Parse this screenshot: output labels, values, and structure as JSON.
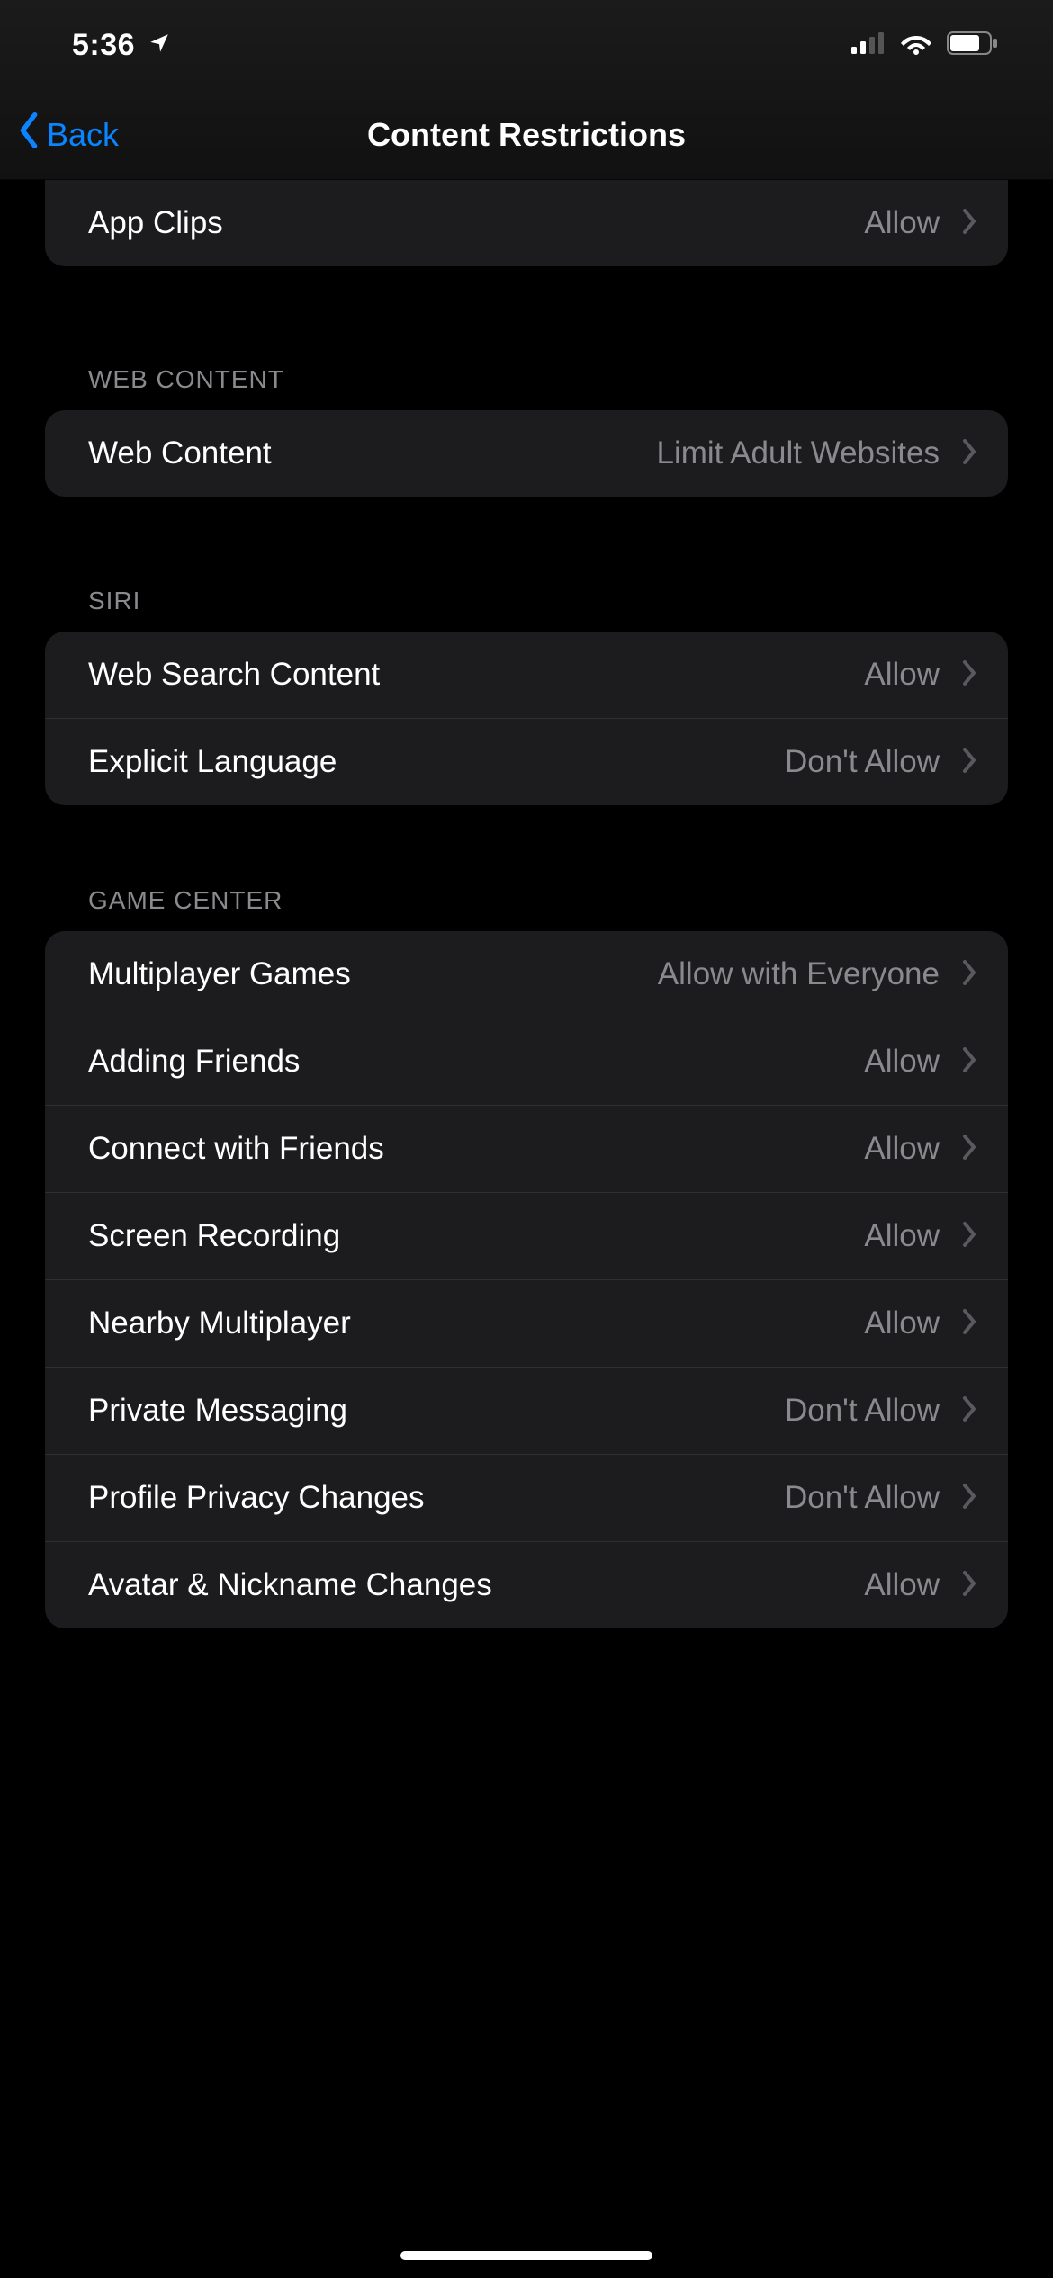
{
  "statusBar": {
    "time": "5:36"
  },
  "nav": {
    "back": "Back",
    "title": "Content Restrictions"
  },
  "groups": {
    "top": {
      "items": [
        {
          "label": "App Clips",
          "value": "Allow"
        }
      ]
    },
    "webContent": {
      "header": "WEB CONTENT",
      "items": [
        {
          "label": "Web Content",
          "value": "Limit Adult Websites"
        }
      ]
    },
    "siri": {
      "header": "SIRI",
      "items": [
        {
          "label": "Web Search Content",
          "value": "Allow"
        },
        {
          "label": "Explicit Language",
          "value": "Don't Allow"
        }
      ]
    },
    "gameCenter": {
      "header": "GAME CENTER",
      "items": [
        {
          "label": "Multiplayer Games",
          "value": "Allow with Everyone"
        },
        {
          "label": "Adding Friends",
          "value": "Allow"
        },
        {
          "label": "Connect with Friends",
          "value": "Allow"
        },
        {
          "label": "Screen Recording",
          "value": "Allow"
        },
        {
          "label": "Nearby Multiplayer",
          "value": "Allow"
        },
        {
          "label": "Private Messaging",
          "value": "Don't Allow"
        },
        {
          "label": "Profile Privacy Changes",
          "value": "Don't Allow"
        },
        {
          "label": "Avatar & Nickname Changes",
          "value": "Allow"
        }
      ]
    }
  }
}
